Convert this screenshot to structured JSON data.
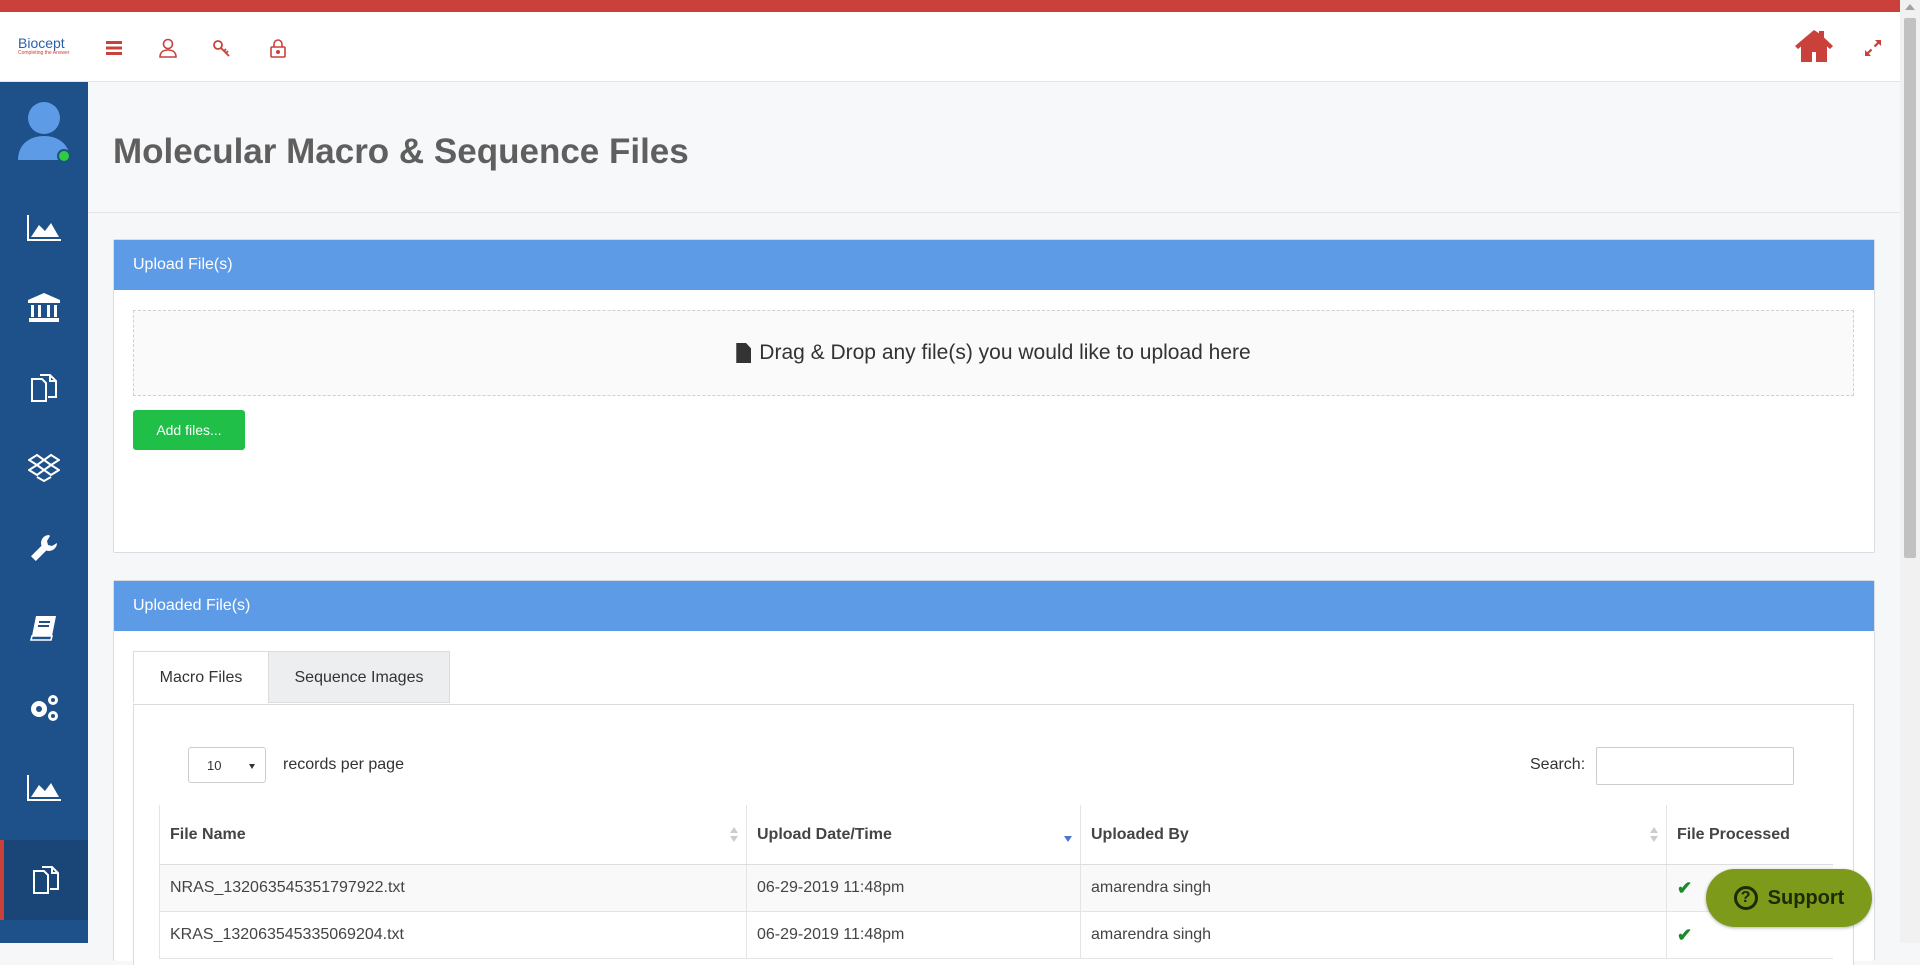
{
  "header": {
    "logo_text_main": "Biocept",
    "logo_tagline": "Completing the Answer",
    "icons": [
      "menu-icon",
      "user-icon",
      "key-icon",
      "lock-icon",
      "home-icon",
      "expand-icon"
    ],
    "brand_color": "#c9413a"
  },
  "sidebar": {
    "bg_color": "#1e5089",
    "items": [
      {
        "icon": "area-chart-icon"
      },
      {
        "icon": "bank-icon"
      },
      {
        "icon": "documents-icon"
      },
      {
        "icon": "dropbox-icon"
      },
      {
        "icon": "wrench-icon"
      },
      {
        "icon": "book-icon"
      },
      {
        "icon": "gears-icon"
      },
      {
        "icon": "area-chart-icon"
      },
      {
        "icon": "documents-icon",
        "active": true
      }
    ]
  },
  "page": {
    "title": "Molecular Macro & Sequence Files"
  },
  "upload_panel": {
    "title": "Upload File(s)",
    "dropzone_text": "Drag & Drop any file(s) you would like to upload here",
    "add_button": "Add files..."
  },
  "uploaded_panel": {
    "title": "Uploaded File(s)",
    "tabs": [
      {
        "label": "Macro Files",
        "active": true
      },
      {
        "label": "Sequence Images",
        "active": false
      }
    ],
    "page_length": "10",
    "page_length_label": "records per page",
    "search_label": "Search:",
    "search_value": "",
    "columns": [
      "File Name",
      "Upload Date/Time",
      "Uploaded By",
      "File Processed"
    ],
    "rows": [
      {
        "file_name": "NRAS_132063545351797922.txt",
        "upload_date": "06-29-2019 11:48pm",
        "uploaded_by": "amarendra singh",
        "processed": "✔"
      },
      {
        "file_name": "KRAS_132063545335069204.txt",
        "upload_date": "06-29-2019 11:48pm",
        "uploaded_by": "amarendra singh",
        "processed": "✔"
      }
    ]
  },
  "support_button": {
    "label": "Support",
    "color": "#7d9a1a"
  }
}
